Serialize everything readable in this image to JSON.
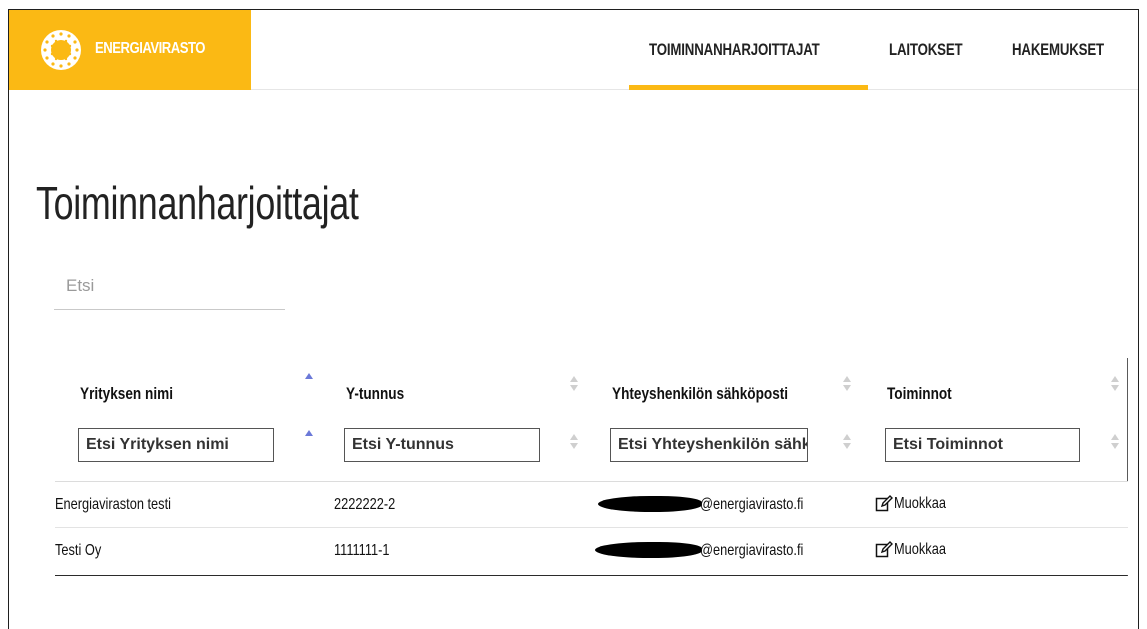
{
  "header": {
    "brand": "ENERGIAVIRASTO",
    "nav": [
      {
        "label": "TOIMINNANHARJOITTAJAT",
        "active": true
      },
      {
        "label": "LAITOKSET",
        "active": false
      },
      {
        "label": "HAKEMUKSET",
        "active": false
      }
    ]
  },
  "page": {
    "title": "Toiminnanharjoittajat",
    "search_placeholder": "Etsi"
  },
  "table": {
    "columns": [
      {
        "label": "Yrityksen nimi",
        "sort": "ascending",
        "filter_placeholder": "Etsi Yrityksen nimi"
      },
      {
        "label": "Y-tunnus",
        "sort": "none",
        "filter_placeholder": "Etsi Y-tunnus"
      },
      {
        "label": "Yhteyshenkilön sähköposti",
        "sort": "none",
        "filter_placeholder": "Etsi Yhteyshenkilön sähköposti"
      },
      {
        "label": "Toiminnot",
        "sort": "none",
        "filter_placeholder": "Etsi Toiminnot"
      }
    ],
    "rows": [
      {
        "name": "Energiaviraston testi",
        "ytunnus": "2222222-2",
        "email_domain": "@energiavirasto.fi",
        "action": "Muokkaa"
      },
      {
        "name": "Testi Oy",
        "ytunnus": "1111111-1",
        "email_domain": "@energiavirasto.fi",
        "action": "Muokkaa"
      }
    ]
  },
  "colors": {
    "brand_yellow": "#fbb914",
    "sort_active": "#6b79d8"
  }
}
